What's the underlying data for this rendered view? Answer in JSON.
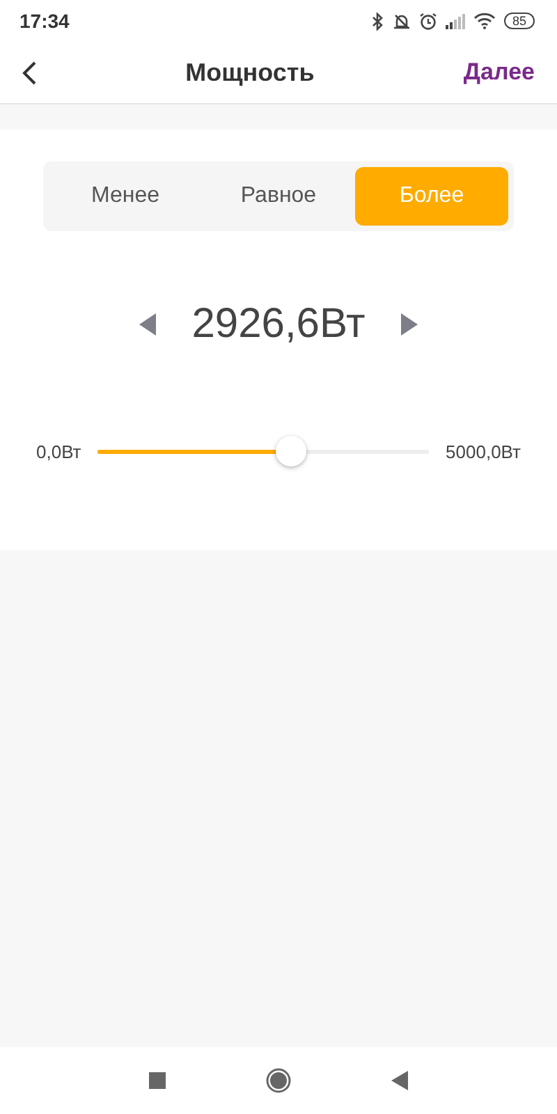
{
  "status_bar": {
    "time": "17:34",
    "battery": "85"
  },
  "header": {
    "title": "Мощность",
    "action": "Далее"
  },
  "segments": [
    {
      "label": "Менее",
      "selected": false
    },
    {
      "label": "Равное",
      "selected": false
    },
    {
      "label": "Более",
      "selected": true
    }
  ],
  "value": "2926,6Вт",
  "slider": {
    "min_label": "0,0Вт",
    "max_label": "5000,0Вт",
    "level": 0.585
  }
}
